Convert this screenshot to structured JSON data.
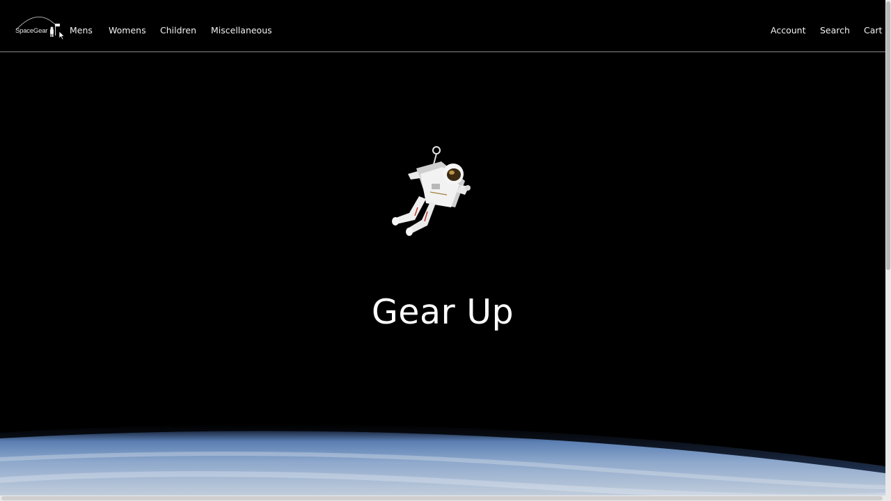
{
  "header": {
    "logo": {
      "text": "SpaceGear",
      "icon": "astronaut-flag-logo-icon"
    },
    "nav_left": [
      {
        "label": "Mens"
      },
      {
        "label": "Womens"
      },
      {
        "label": "Children"
      },
      {
        "label": "Miscellaneous"
      }
    ],
    "nav_right": [
      {
        "label": "Account"
      },
      {
        "label": "Search"
      },
      {
        "label": "Cart"
      }
    ]
  },
  "hero": {
    "title": "Gear Up",
    "image": "floating-astronaut-illustration",
    "background": "earth-horizon-space-backdrop"
  },
  "colors": {
    "background": "#000000",
    "text": "#ffffff",
    "header_border": "#8a8a8a",
    "earth_glow": "#6f93c4"
  }
}
